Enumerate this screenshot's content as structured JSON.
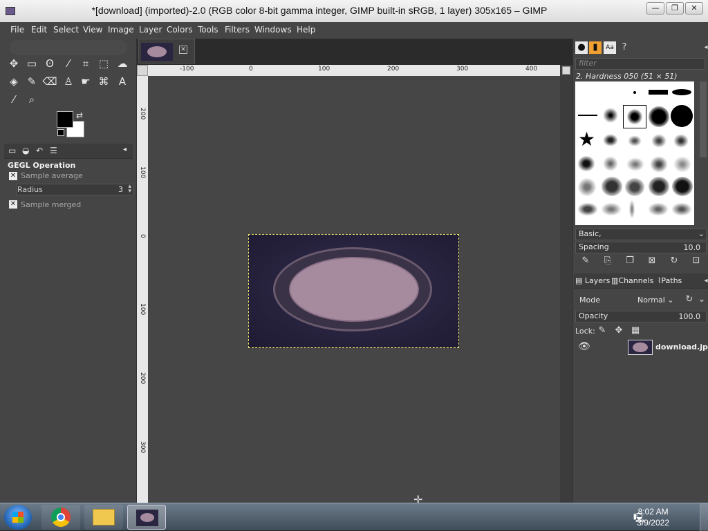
{
  "window": {
    "title": "*[download] (imported)-2.0 (RGB color 8-bit gamma integer, GIMP built-in sRGB, 1 layer) 305x165 – GIMP",
    "minimize": "—",
    "maximize": "❐",
    "close": "✕"
  },
  "menubar": {
    "items": [
      "File",
      "Edit",
      "Select",
      "View",
      "Image",
      "Layer",
      "Colors",
      "Tools",
      "Filters",
      "Windows",
      "Help"
    ]
  },
  "tool_options": {
    "title": "GEGL Operation",
    "sample_average_label": "Sample average",
    "radius_label": "Radius",
    "radius_value": "3",
    "sample_merged_label": "Sample merged"
  },
  "colors": {
    "foreground": "#000000",
    "background": "#ffffff",
    "selection_outline": "#e8e36a"
  },
  "rulers": {
    "horizontal": [
      "-100",
      "0",
      "100",
      "200",
      "300",
      "400"
    ],
    "vertical": [
      "200",
      "100",
      "0",
      "100",
      "200",
      "300"
    ]
  },
  "brushes": {
    "filter_placeholder": "filter",
    "selected_brush": "2. Hardness 050 (51 × 51)",
    "preset": "Basic,",
    "spacing_label": "Spacing",
    "spacing_value": "10.0"
  },
  "layers_panel": {
    "tabs": [
      "Layers",
      "Channels",
      "Paths"
    ],
    "mode_label": "Mode",
    "mode_value": "Normal",
    "opacity_label": "Opacity",
    "opacity_value": "100.0",
    "lock_label": "Lock:",
    "layers": [
      {
        "name": "download.jpg",
        "visible": true
      }
    ]
  },
  "taskbar": {
    "time": "8:02 AM",
    "date": "3/9/2022"
  }
}
